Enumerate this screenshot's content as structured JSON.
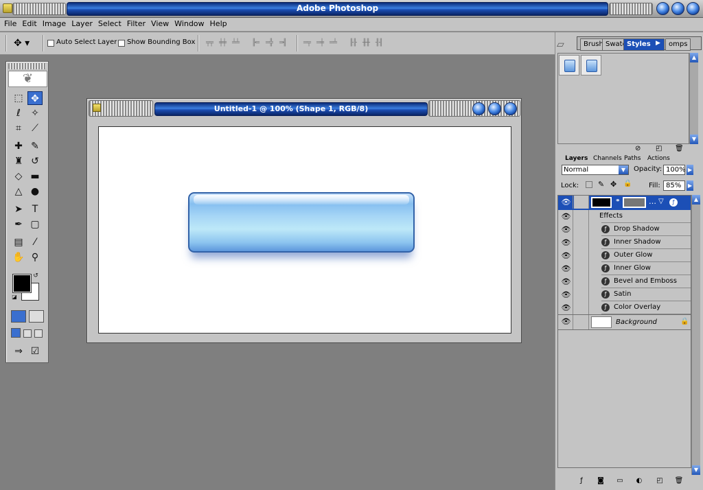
{
  "app": {
    "title": "Adobe Photoshop"
  },
  "menu": [
    "File",
    "Edit",
    "Image",
    "Layer",
    "Select",
    "Filter",
    "View",
    "Window",
    "Help"
  ],
  "options": {
    "auto_select_label": "Auto Select Layer",
    "auto_select_checked": false,
    "bounding_box_label": "Show Bounding Box",
    "bounding_box_checked": false
  },
  "document": {
    "title": "Untitled-1 @ 100% (Shape 1, RGB/8)"
  },
  "styles_panel": {
    "tabs": [
      "Brush",
      "Swatc",
      "Styles",
      "omps"
    ],
    "active_tab": "Styles"
  },
  "layers_panel": {
    "tabs": [
      "Layers",
      "Channels",
      "Paths",
      "Actions"
    ],
    "blend_mode": "Normal",
    "opacity_label": "Opacity:",
    "opacity_value": "100%",
    "lock_label": "Lock:",
    "fill_label": "Fill:",
    "fill_value": "85%",
    "effects_label": "Effects",
    "effects": [
      "Drop Shadow",
      "Inner Shadow",
      "Outer Glow",
      "Inner Glow",
      "Bevel and Emboss",
      "Satin",
      "Color Overlay"
    ],
    "background_label": "Background"
  },
  "colors": {
    "titlebar_blue": "#1c4fb6",
    "workspace": "#7f7f7f",
    "panel": "#c4c4c4",
    "button_glass": "#a7d6f6"
  }
}
